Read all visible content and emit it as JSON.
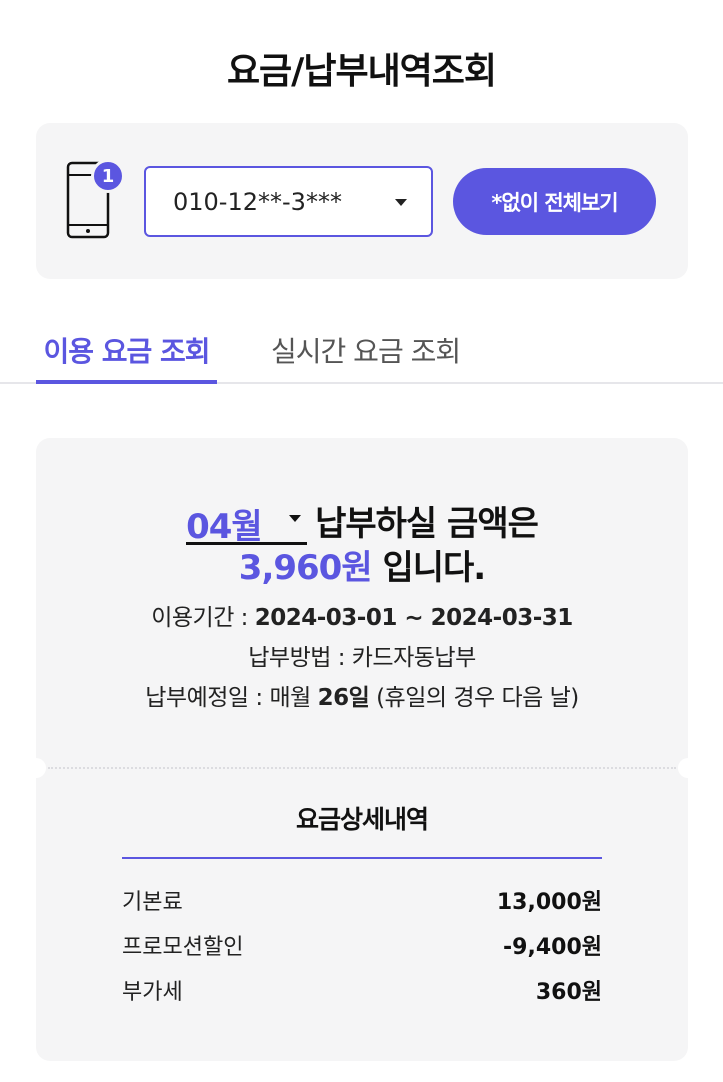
{
  "header": {
    "title": "요금/납부내역조회"
  },
  "line_selector": {
    "badge_count": "1",
    "selected_number": "010-12**-3***",
    "view_all_label": "*없이 전체보기"
  },
  "tabs": [
    {
      "label": "이용 요금 조회",
      "active": true
    },
    {
      "label": "실시간 요금 조회",
      "active": false
    }
  ],
  "bill": {
    "month": "04월",
    "headline_suffix": "납부하실 금액은",
    "amount": "3,960원",
    "amount_suffix": "입니다.",
    "period_label": "이용기간 :",
    "period_value": "2024-03-01 ~ 2024-03-31",
    "method_label": "납부방법 :",
    "method_value": "카드자동납부",
    "due_label": "납부예정일 :",
    "due_prefix": "매월",
    "due_day": "26일",
    "due_note": "(휴일의 경우 다음 날)"
  },
  "details": {
    "title": "요금상세내역",
    "rows": [
      {
        "label": "기본료",
        "amount": "13,000원"
      },
      {
        "label": "프로모션할인",
        "amount": "-9,400원"
      },
      {
        "label": "부가세",
        "amount": "360원"
      }
    ]
  },
  "colors": {
    "accent": "#5b56e0",
    "card_bg": "#f5f5f6",
    "text": "#111111"
  }
}
